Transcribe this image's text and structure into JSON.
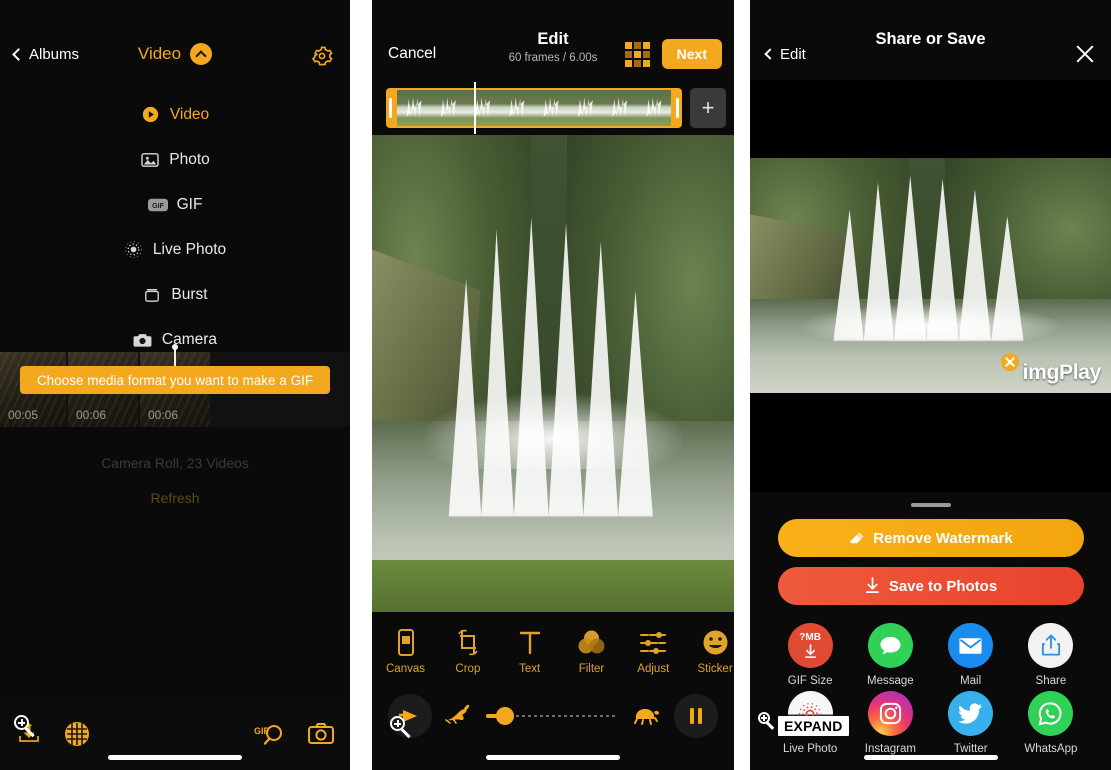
{
  "library": {
    "back_label": "Albums",
    "title": "Video",
    "gear_icon": "gear-icon",
    "menu": [
      {
        "label": "Video",
        "icon": "play-circle-icon",
        "active": true
      },
      {
        "label": "Photo",
        "icon": "photo-icon",
        "active": false
      },
      {
        "label": "GIF",
        "icon": "gif-badge-icon",
        "active": false
      },
      {
        "label": "Live Photo",
        "icon": "live-photo-icon",
        "active": false
      },
      {
        "label": "Burst",
        "icon": "burst-icon",
        "active": false
      },
      {
        "label": "Camera",
        "icon": "camera-icon",
        "active": false
      }
    ],
    "tooltip": "Choose media format you want to make a GIF",
    "thumb_times": [
      "00:05",
      "00:06",
      "00:06"
    ],
    "caption": "Camera Roll, 23 Videos",
    "refresh": "Refresh",
    "tabbar": {
      "import": "import-icon",
      "pattern": "pattern-ball-icon",
      "gif_search": "gif-search-icon",
      "camera": "camera-icon"
    }
  },
  "edit": {
    "cancel_label": "Cancel",
    "title": "Edit",
    "subtitle": "60 frames / 6.00s",
    "grid_icon": "grid-icon",
    "next_label": "Next",
    "add_label": "+",
    "tools": [
      {
        "label": "Canvas",
        "icon": "canvas-icon"
      },
      {
        "label": "Crop",
        "icon": "crop-icon"
      },
      {
        "label": "Text",
        "icon": "text-icon"
      },
      {
        "label": "Filter",
        "icon": "filter-icon"
      },
      {
        "label": "Adjust",
        "icon": "adjust-icon"
      },
      {
        "label": "Sticker",
        "icon": "sticker-icon"
      }
    ],
    "playback": {
      "play_icon": "play-icon",
      "slow_icon": "rabbit-icon",
      "fast_icon": "turtle-icon",
      "pause_icon": "pause-icon"
    }
  },
  "share": {
    "back_label": "Edit",
    "title": "Share or Save",
    "close_icon": "close-icon",
    "watermark_text": "imgPlay",
    "watermark_close_icon": "close-circle-icon",
    "remove_watermark_label": "Remove Watermark",
    "remove_watermark_icon": "eraser-icon",
    "save_label": "Save to Photos",
    "save_icon": "download-icon",
    "items": [
      {
        "label": "GIF Size",
        "icon": "gifsize-icon",
        "badge": "?MB"
      },
      {
        "label": "Message",
        "icon": "message-icon"
      },
      {
        "label": "Mail",
        "icon": "mail-icon"
      },
      {
        "label": "Share",
        "icon": "share-icon"
      },
      {
        "label": "Live Photo",
        "icon": "live-photo-icon"
      },
      {
        "label": "Instagram",
        "icon": "instagram-icon"
      },
      {
        "label": "Twitter",
        "icon": "twitter-icon"
      },
      {
        "label": "WhatsApp",
        "icon": "whatsapp-icon"
      }
    ]
  },
  "cursor": {
    "expand_label": "EXPAND",
    "icon": "magnifier-zoom-in-cursor"
  },
  "colors": {
    "accent": "#f4a81d",
    "background": "#0a0a0a",
    "save_red": "#e8422c",
    "gifsize_red": "#e04a32",
    "message_green": "#31d158",
    "mail_blue": "#1a8cf0",
    "twitter_blue": "#37b0eb",
    "whatsapp_green": "#31d158"
  }
}
